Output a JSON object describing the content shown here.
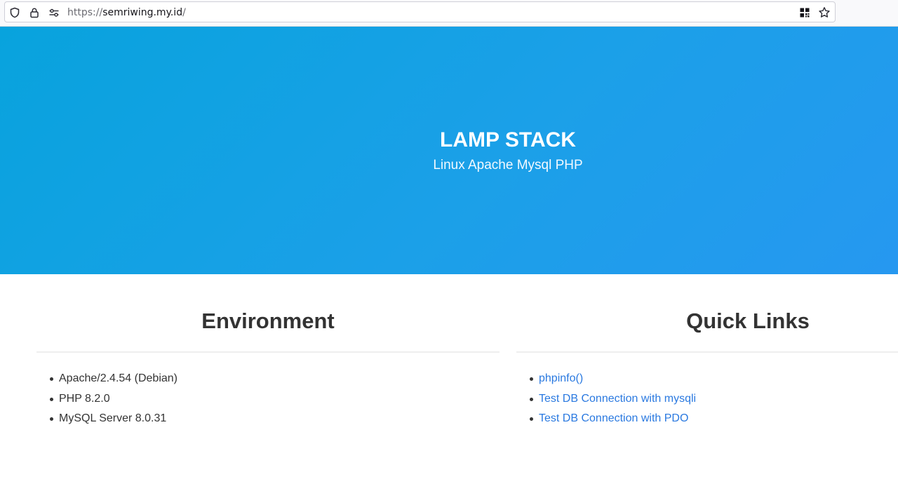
{
  "browser": {
    "url_protocol": "https://",
    "url_host": "semriwing.my.id",
    "url_path": "/"
  },
  "hero": {
    "title": "LAMP STACK",
    "subtitle": "Linux Apache Mysql PHP"
  },
  "environment": {
    "heading": "Environment",
    "items": [
      "Apache/2.4.54 (Debian)",
      "PHP 8.2.0",
      "MySQL Server 8.0.31"
    ]
  },
  "quick_links": {
    "heading": "Quick Links",
    "links": [
      "phpinfo()",
      "Test DB Connection with mysqli",
      "Test DB Connection with PDO"
    ]
  },
  "colors": {
    "hero_gradient_start": "#08a3dd",
    "hero_gradient_end": "#2698f0",
    "link": "#2a79e0",
    "text": "#333333"
  },
  "icons": [
    "shield-icon",
    "lock-icon",
    "connection-settings-icon",
    "qr-code-icon",
    "bookmark-star-icon"
  ]
}
